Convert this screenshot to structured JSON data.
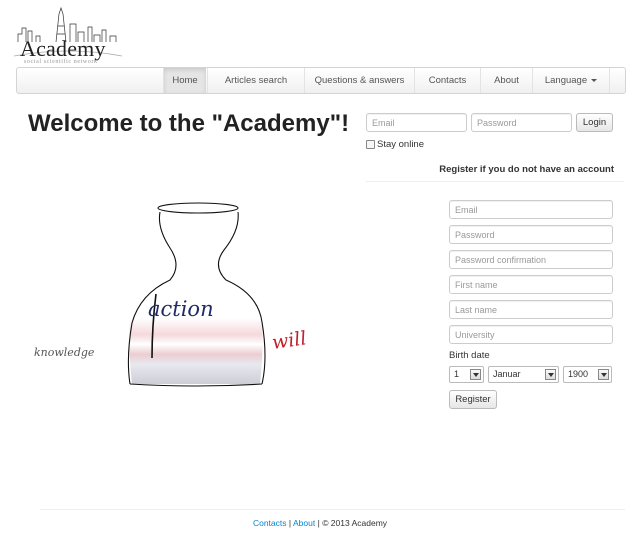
{
  "logo": {
    "title": "Academy",
    "subtitle": "social scientific network"
  },
  "nav": {
    "items": [
      {
        "label": "Home",
        "active": true
      },
      {
        "label": "Articles search",
        "active": false
      },
      {
        "label": "Questions & answers",
        "active": false
      },
      {
        "label": "Contacts",
        "active": false
      },
      {
        "label": "About",
        "active": false
      },
      {
        "label": "Language",
        "active": false,
        "dropdown": true
      }
    ]
  },
  "heading": "Welcome to the \"Academy\"!",
  "login": {
    "email_placeholder": "Email",
    "password_placeholder": "Password",
    "login_label": "Login",
    "stay_online_label": "Stay online"
  },
  "register": {
    "hint": "Register if you do not have an account",
    "fields": {
      "email": "Email",
      "password": "Password",
      "password_confirmation": "Password confirmation",
      "first_name": "First name",
      "last_name": "Last name",
      "university": "University"
    },
    "birth_date_label": "Birth date",
    "birth_day": "1",
    "birth_month": "Januar",
    "birth_year": "1900",
    "button_label": "Register"
  },
  "illustration": {
    "words": {
      "knowledge": "knowledge",
      "action": "action",
      "will": "will"
    }
  },
  "footer": {
    "contacts": "Contacts",
    "about": "About",
    "copyright": "© 2013 Academy",
    "separator": "|"
  }
}
